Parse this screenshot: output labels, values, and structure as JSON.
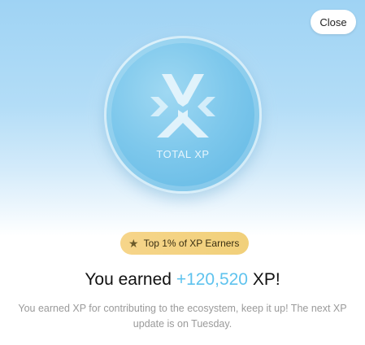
{
  "modal": {
    "close_label": "Close",
    "coin_label": "TOTAL XP",
    "badge_label": "Top 1% of XP Earners",
    "badge_icon": "star-icon",
    "headline_prefix": "You earned ",
    "xp_amount": "+120,520",
    "headline_suffix": " XP!",
    "description": "You earned XP for contributing to the ecosystem, keep it up! The next XP update is on Tuesday.",
    "colors": {
      "accent": "#5fc3ee",
      "badge": "#f6d58a",
      "coin": "#7ec8ec"
    }
  }
}
